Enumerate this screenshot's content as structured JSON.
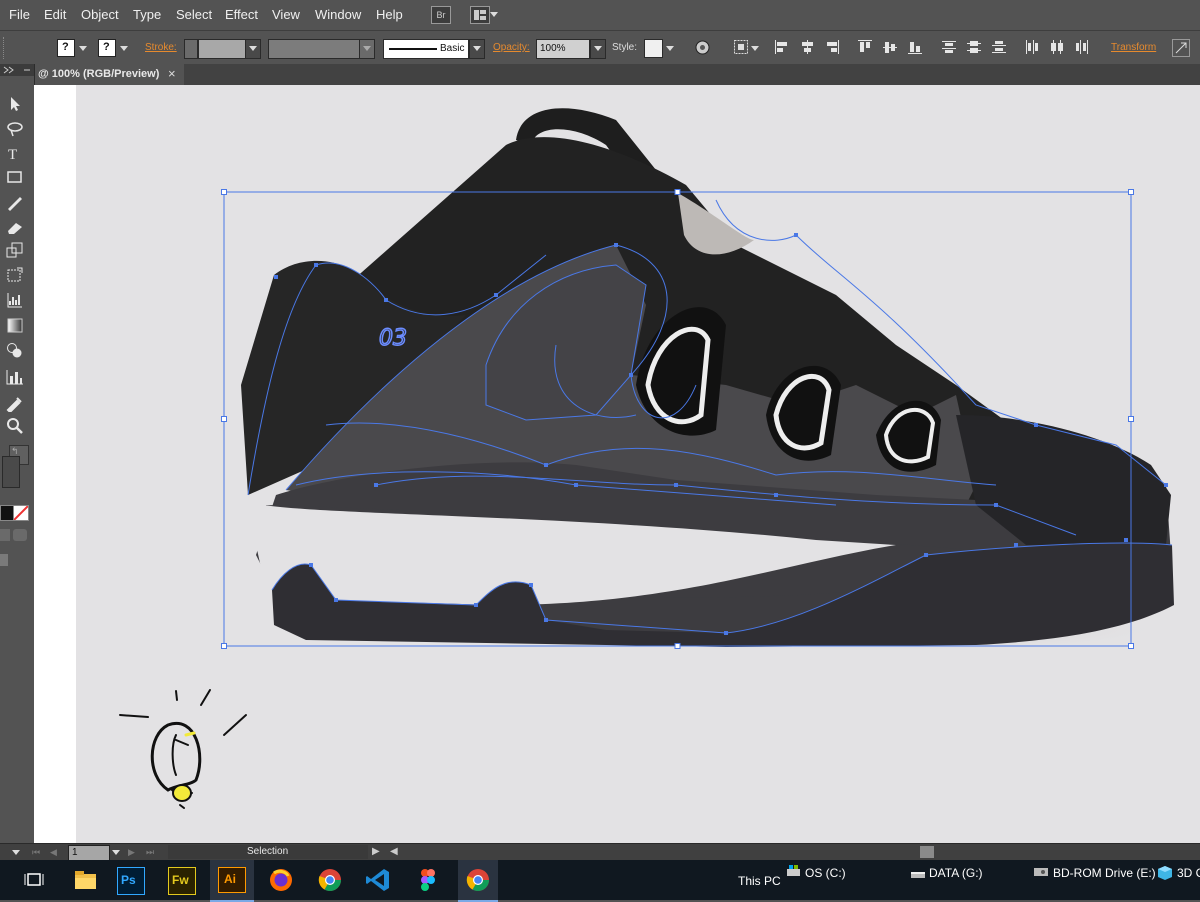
{
  "menu": {
    "items": [
      "File",
      "Edit",
      "Object",
      "Type",
      "Select",
      "Effect",
      "View",
      "Window",
      "Help"
    ],
    "bridge_label": "Br"
  },
  "control": {
    "stroke_label": "Stroke:",
    "stroke_profile": "Basic",
    "opacity_label": "Opacity:",
    "opacity_value": "100%",
    "style_label": "Style:",
    "transform_label": "Transform"
  },
  "document": {
    "tab_title": "@ 100% (RGB/Preview)",
    "close_symbol": "×"
  },
  "status": {
    "page_number": "1",
    "tool_name": "Selection"
  },
  "taskbar": {
    "apps": [
      "task-view-icon",
      "file-explorer-icon",
      "photoshop-icon",
      "fireworks-icon",
      "illustrator-icon",
      "firefox-icon",
      "chrome-icon",
      "vscode-icon",
      "figma-icon",
      "chrome-icon"
    ],
    "ps_label": "Ps",
    "fw_label": "Fw",
    "ai_label": "Ai",
    "this_pc": "This PC",
    "drives": [
      "OS (C:)",
      "DATA (G:)",
      "BD-ROM Drive (E:)",
      "3D C"
    ]
  },
  "colors": {
    "ui_bg": "#535353",
    "artboard": "#e3e2e4",
    "selection_blue": "#4a78e6",
    "accent_orange": "#e68a2e"
  }
}
